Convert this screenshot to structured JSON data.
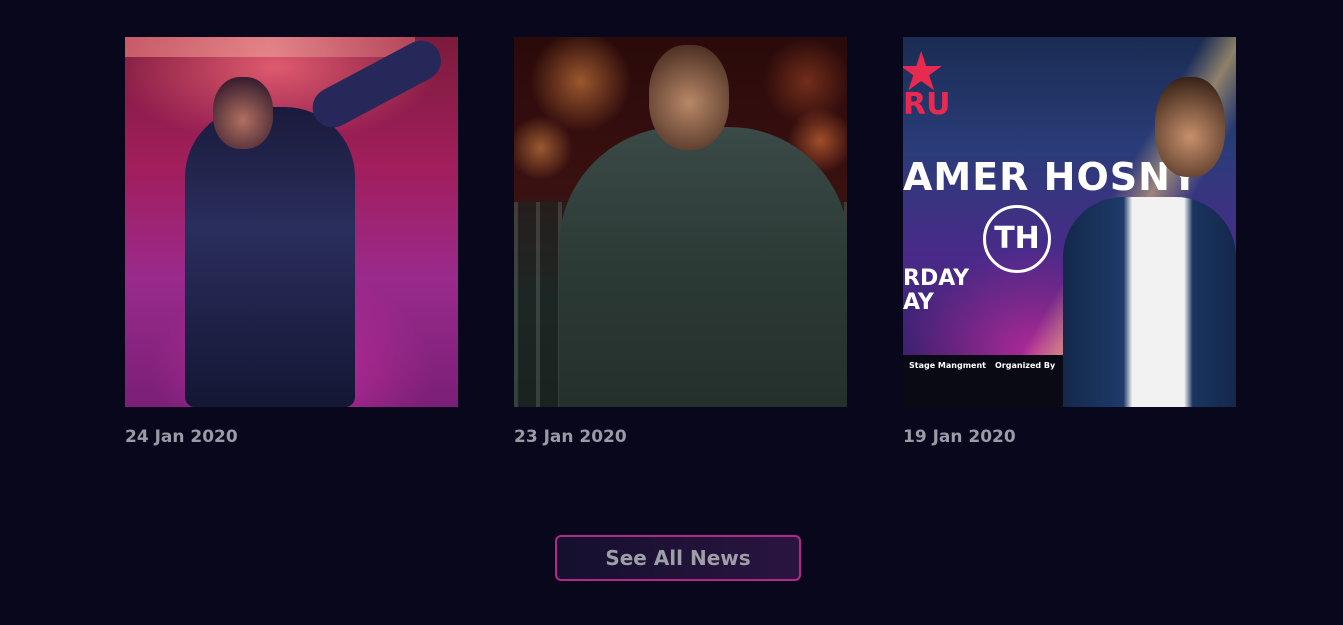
{
  "news": {
    "items": [
      {
        "date": "24 Jan 2020"
      },
      {
        "date": "23 Jan 2020"
      },
      {
        "date": "19 Jan 2020",
        "poster": {
          "title": "AMER HOSNY",
          "badge": "RU",
          "day": "RDAY\nAY",
          "stage_label": "Stage Mangment",
          "organized_label": "Organized By"
        }
      }
    ],
    "see_all_label": "See All News"
  },
  "colors": {
    "background": "#08071c",
    "date_text": "#9a9aa6",
    "button_border": "#b0288a",
    "button_text": "#9e9ea8"
  }
}
